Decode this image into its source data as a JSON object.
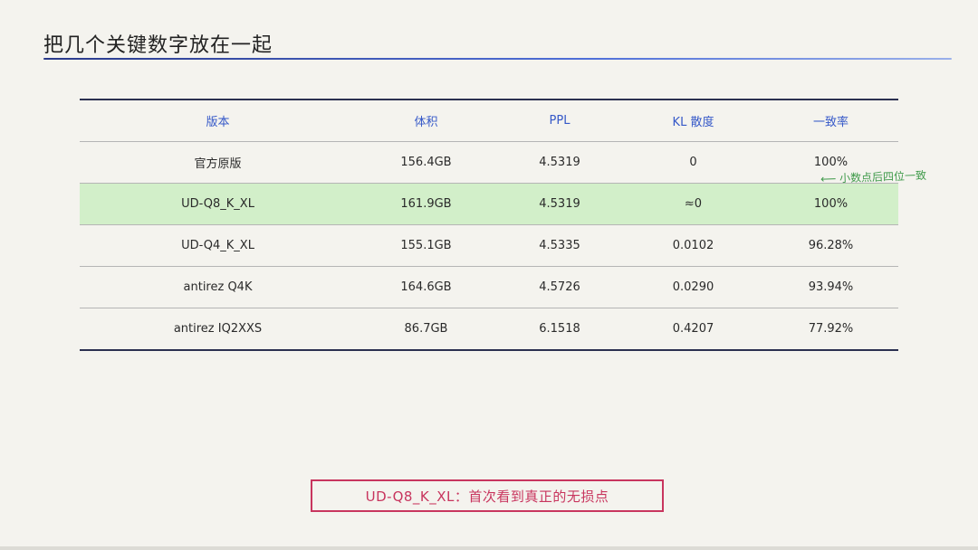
{
  "slide": {
    "title": "把几个关键数字放在一起"
  },
  "table": {
    "headers": [
      "版本",
      "体积",
      "PPL",
      "KL 散度",
      "一致率"
    ],
    "rows": [
      [
        "官方原版",
        "156.4GB",
        "4.5319",
        "0",
        "100%"
      ],
      [
        "UD-Q8_K_XL",
        "161.9GB",
        "4.5319",
        "≈0",
        "100%"
      ],
      [
        "UD-Q4_K_XL",
        "155.1GB",
        "4.5335",
        "0.0102",
        "96.28%"
      ],
      [
        "antirez Q4K",
        "164.6GB",
        "4.5726",
        "0.0290",
        "93.94%"
      ],
      [
        "antirez IQ2XXS",
        "86.7GB",
        "6.1518",
        "0.4207",
        "77.92%"
      ]
    ],
    "highlight_row_index": 1
  },
  "annotation": {
    "text": "⟵ 小数点后四位一致"
  },
  "callout": {
    "text": "UD-Q8_K_XL：首次看到真正的无损点"
  },
  "colors": {
    "header_text": "#3558c8",
    "highlight_row": "#d2efc9",
    "note_green": "#3f9a4a",
    "callout_red": "#c8355e",
    "rule_dark": "#2b3050"
  }
}
